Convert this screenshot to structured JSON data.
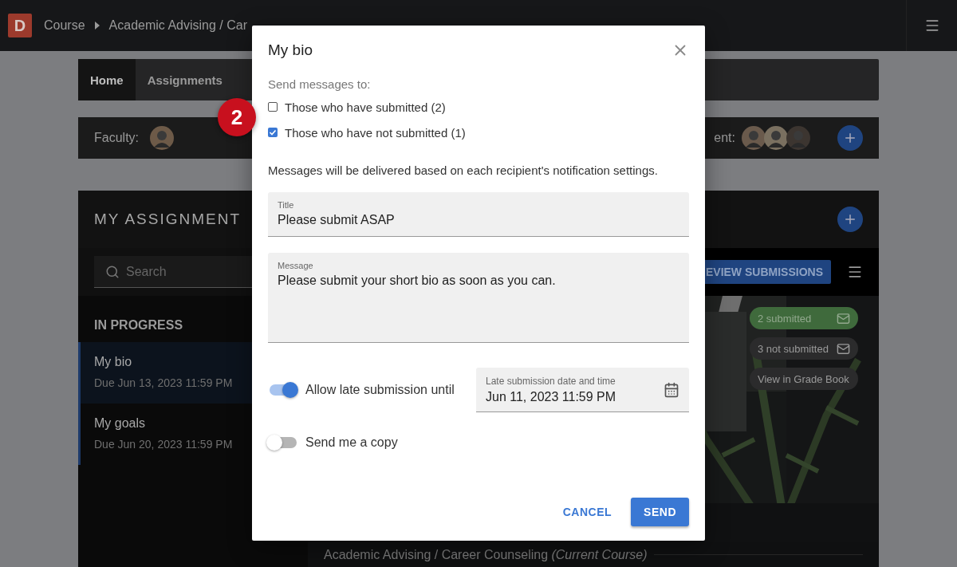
{
  "top_bar": {
    "logo": "D",
    "breadcrumbs": [
      "Course",
      "Academic Advising / Car"
    ]
  },
  "tabs": [
    {
      "label": "Home",
      "selected": true
    },
    {
      "label": "Assignments",
      "selected": false
    }
  ],
  "people_bar": {
    "faculty_label": "Faculty:",
    "faculty": [
      {
        "kind": "avatar"
      }
    ],
    "student_label": "ent:",
    "students": [
      {
        "kind": "avatar"
      },
      {
        "kind": "avatar"
      },
      {
        "kind": "avatar"
      }
    ]
  },
  "assignments": {
    "title": "MY ASSIGNMENT",
    "search": {
      "placeholder": "Search"
    },
    "section": "IN PROGRESS",
    "items": [
      {
        "name": "My bio",
        "due": "Due Jun 13, 2023 11:59 PM",
        "selected": true
      },
      {
        "name": "My goals",
        "due": "Due Jun 20, 2023 11:59 PM",
        "selected": false
      }
    ]
  },
  "detail": {
    "primary_button": "EVIEW SUBMISSIONS",
    "chips": [
      {
        "label": "2 submitted",
        "kind": "submitted"
      },
      {
        "label": "3 not submitted",
        "kind": "pending"
      },
      {
        "label": "View in Grade Book",
        "kind": "link"
      }
    ],
    "course": "Academic Advising / Career Counseling *(Current Course)*"
  },
  "dialog": {
    "title": "My bio",
    "recipients_label": "Send messages to:",
    "recipients": [
      {
        "label": "Those who have submitted (2)",
        "checked": false
      },
      {
        "label": "Those who have not submitted (1)",
        "checked": true
      }
    ],
    "note": "Messages will be delivered based on each recipient's notification settings.",
    "fields": [
      {
        "label": "Title",
        "value": "Please submit ASAP",
        "kind": "line"
      },
      {
        "label": "Message",
        "value": "Please submit your short bio as soon as you can.",
        "kind": "multiline"
      }
    ],
    "late_submission": {
      "label": "Allow late submission until",
      "on": true,
      "date_label": "Late submission date and time",
      "date_value": "Jun 11, 2023 11:59 PM"
    },
    "copy": {
      "label": "Send me a copy",
      "on": false
    },
    "buttons": [
      {
        "label": "CANCEL",
        "kind": "text"
      },
      {
        "label": "SEND",
        "kind": "primary"
      }
    ]
  },
  "callout": "2"
}
